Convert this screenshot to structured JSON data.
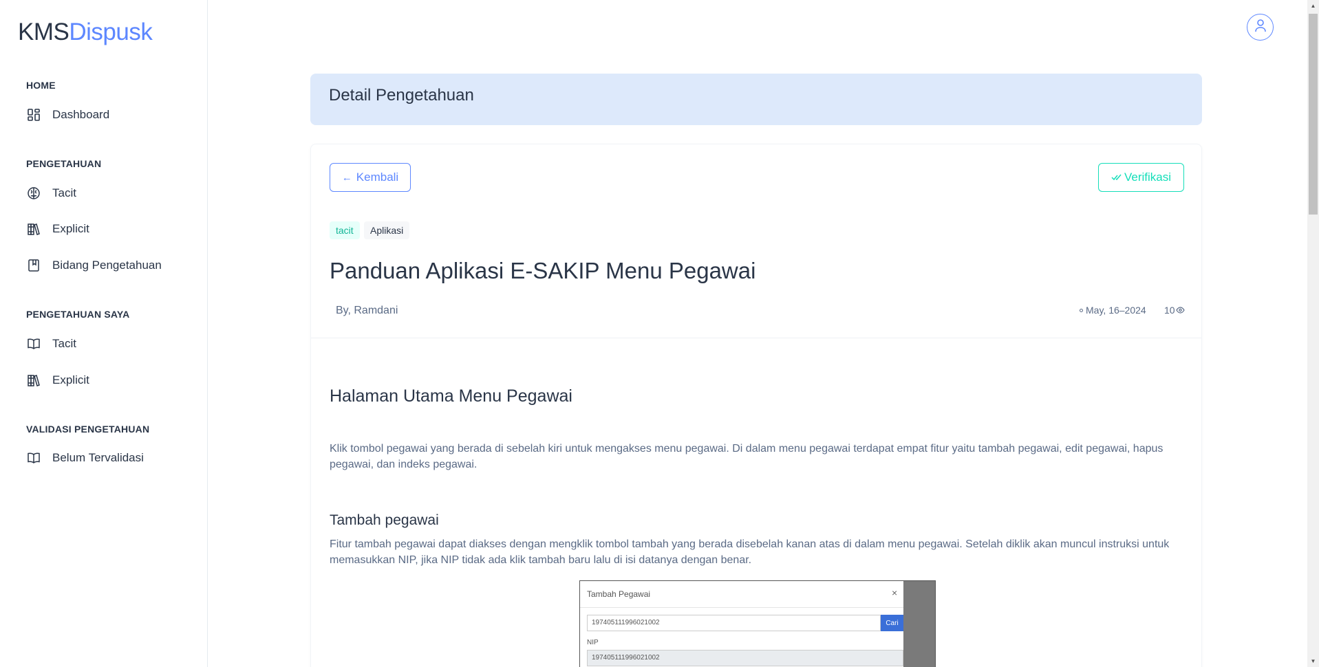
{
  "brand": {
    "part1": "KMS",
    "part2": "Dispusk"
  },
  "sidebar": {
    "sections": [
      {
        "label": "HOME",
        "items": [
          {
            "label": "Dashboard",
            "icon": "dashboard-icon"
          }
        ]
      },
      {
        "label": "PENGETAHUAN",
        "items": [
          {
            "label": "Tacit",
            "icon": "brain-icon"
          },
          {
            "label": "Explicit",
            "icon": "books-icon"
          },
          {
            "label": "Bidang Pengetahuan",
            "icon": "bookmark-icon"
          }
        ]
      },
      {
        "label": "PENGETAHUAN SAYA",
        "items": [
          {
            "label": "Tacit",
            "icon": "book-open-icon"
          },
          {
            "label": "Explicit",
            "icon": "books-icon"
          }
        ]
      },
      {
        "label": "VALIDASI PENGETAHUAN",
        "items": [
          {
            "label": "Belum Tervalidasi",
            "icon": "book-open-icon"
          }
        ]
      }
    ]
  },
  "header": {
    "title": "Detail Pengetahuan"
  },
  "actions": {
    "back_label": "Kembali",
    "verify_label": "Verifikasi"
  },
  "tags": [
    "tacit",
    "Aplikasi"
  ],
  "post": {
    "title": "Panduan Aplikasi E-SAKIP Menu Pegawai",
    "author": "By, Ramdani",
    "date": "May, 16–2024",
    "views": "10"
  },
  "article": {
    "section_title": "Halaman Utama Menu Pegawai",
    "intro": "Klik tombol pegawai yang berada di sebelah kiri untuk mengakses menu pegawai. Di dalam menu pegawai terdapat empat fitur yaitu tambah pegawai, edit pegawai, hapus pegawai, dan indeks pegawai.",
    "subsection_title": "Tambah pegawai",
    "subsection_text": "Fitur tambah pegawai dapat diakses dengan mengklik tombol tambah yang berada disebelah kanan atas di dalam menu pegawai. Setelah diklik akan muncul instruksi untuk memasukkan NIP, jika NIP tidak ada klik tambah baru lalu di isi datanya dengan benar."
  },
  "screenshot": {
    "modal_title": "Tambah Pegawai",
    "close": "×",
    "search_value": "197405111996021002",
    "search_button": "Cari",
    "nip_label": "NIP",
    "nip_value": "197405111996021002"
  },
  "colors": {
    "primary": "#5d87ff",
    "success": "#13deb9",
    "header_bg": "#dde9fb"
  }
}
